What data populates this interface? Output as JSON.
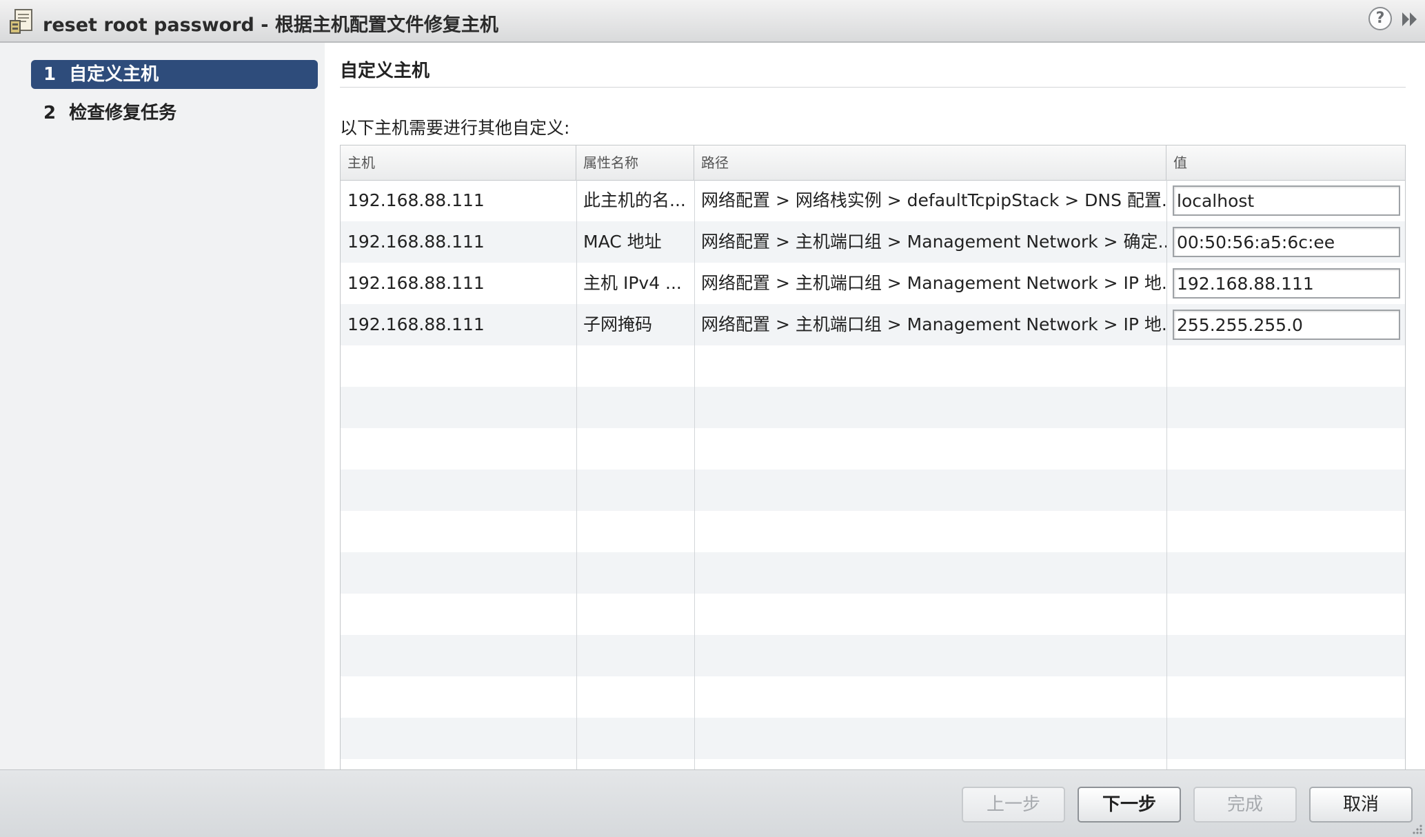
{
  "window": {
    "title": "reset root password - 根据主机配置文件修复主机",
    "help_icon": "?",
    "icons": [
      "profile-document-icon",
      "help-icon",
      "expand-icon"
    ]
  },
  "steps": [
    {
      "num": "1",
      "label": "自定义主机",
      "active": true
    },
    {
      "num": "2",
      "label": "检查修复任务",
      "active": false
    }
  ],
  "main": {
    "title": "自定义主机",
    "instruction": "以下主机需要进行其他自定义:"
  },
  "table": {
    "columns": [
      "主机",
      "属性名称",
      "路径",
      "值"
    ],
    "rows": [
      {
        "host": "192.168.88.111",
        "property": "此主机的名...",
        "path": "网络配置 > 网络栈实例 > defaultTcpipStack > DNS 配置...",
        "value": "localhost"
      },
      {
        "host": "192.168.88.111",
        "property": "MAC 地址",
        "path": "网络配置 > 主机端口组 > Management Network > 确定...",
        "value": "00:50:56:a5:6c:ee"
      },
      {
        "host": "192.168.88.111",
        "property": "主机 IPv4 ...",
        "path": "网络配置 > 主机端口组 > Management Network > IP 地...",
        "value": "192.168.88.111"
      },
      {
        "host": "192.168.88.111",
        "property": "子网掩码",
        "path": "网络配置 > 主机端口组 > Management Network > IP 地...",
        "value": "255.255.255.0"
      }
    ]
  },
  "footer": {
    "back_label": "上一步",
    "next_label": "下一步",
    "finish_label": "完成",
    "cancel_label": "取消"
  },
  "colors": {
    "active_step": "#2e4c7b",
    "row_alt": "#f2f4f6"
  }
}
